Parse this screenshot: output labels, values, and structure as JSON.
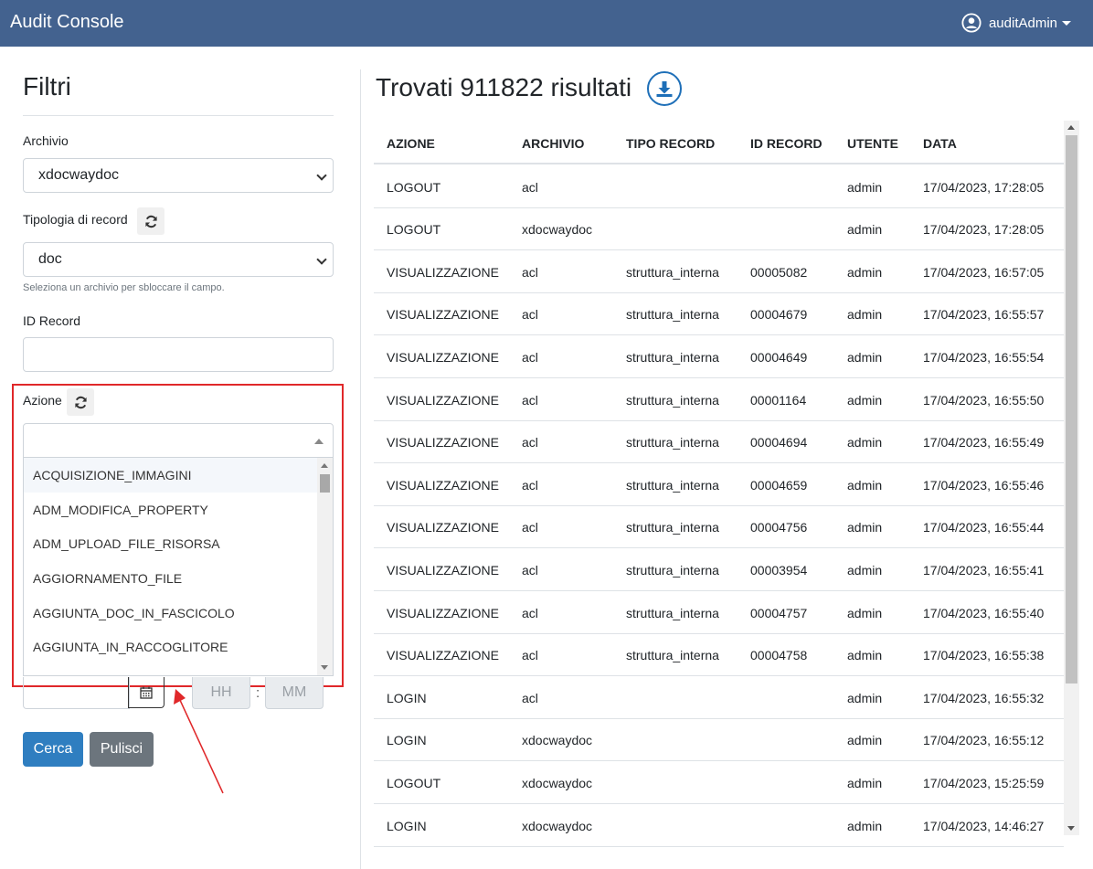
{
  "navbar": {
    "brand": "Audit Console",
    "user": "auditAdmin",
    "user_icon": "user-circle-icon"
  },
  "sidebar": {
    "title": "Filtri",
    "archivio": {
      "label": "Archivio",
      "value": "xdocwaydoc"
    },
    "tipologia": {
      "label": "Tipologia di record",
      "value": "doc",
      "hint": "Seleziona un archivio per sbloccare il campo."
    },
    "id_record": {
      "label": "ID Record",
      "value": ""
    },
    "azione": {
      "label": "Azione",
      "value": "",
      "options": [
        "ACQUISIZIONE_IMMAGINI",
        "ADM_MODIFICA_PROPERTY",
        "ADM_UPLOAD_FILE_RISORSA",
        "AGGIORNAMENTO_FILE",
        "AGGIUNTA_DOC_IN_FASCICOLO",
        "AGGIUNTA_IN_RACCOGLITORE"
      ]
    },
    "time": {
      "hh_placeholder": "HH",
      "mm_placeholder": "MM",
      "separator": ":"
    },
    "buttons": {
      "search": "Cerca",
      "clear": "Pulisci"
    }
  },
  "results": {
    "title": "Trovati 911822 risultati",
    "columns": [
      "AZIONE",
      "ARCHIVIO",
      "TIPO RECORD",
      "ID RECORD",
      "UTENTE",
      "DATA"
    ],
    "rows": [
      [
        "LOGOUT",
        "acl",
        "",
        "",
        "admin",
        "17/04/2023, 17:28:05"
      ],
      [
        "LOGOUT",
        "xdocwaydoc",
        "",
        "",
        "admin",
        "17/04/2023, 17:28:05"
      ],
      [
        "VISUALIZZAZIONE",
        "acl",
        "struttura_interna",
        "00005082",
        "admin",
        "17/04/2023, 16:57:05"
      ],
      [
        "VISUALIZZAZIONE",
        "acl",
        "struttura_interna",
        "00004679",
        "admin",
        "17/04/2023, 16:55:57"
      ],
      [
        "VISUALIZZAZIONE",
        "acl",
        "struttura_interna",
        "00004649",
        "admin",
        "17/04/2023, 16:55:54"
      ],
      [
        "VISUALIZZAZIONE",
        "acl",
        "struttura_interna",
        "00001164",
        "admin",
        "17/04/2023, 16:55:50"
      ],
      [
        "VISUALIZZAZIONE",
        "acl",
        "struttura_interna",
        "00004694",
        "admin",
        "17/04/2023, 16:55:49"
      ],
      [
        "VISUALIZZAZIONE",
        "acl",
        "struttura_interna",
        "00004659",
        "admin",
        "17/04/2023, 16:55:46"
      ],
      [
        "VISUALIZZAZIONE",
        "acl",
        "struttura_interna",
        "00004756",
        "admin",
        "17/04/2023, 16:55:44"
      ],
      [
        "VISUALIZZAZIONE",
        "acl",
        "struttura_interna",
        "00003954",
        "admin",
        "17/04/2023, 16:55:41"
      ],
      [
        "VISUALIZZAZIONE",
        "acl",
        "struttura_interna",
        "00004757",
        "admin",
        "17/04/2023, 16:55:40"
      ],
      [
        "VISUALIZZAZIONE",
        "acl",
        "struttura_interna",
        "00004758",
        "admin",
        "17/04/2023, 16:55:38"
      ],
      [
        "LOGIN",
        "acl",
        "",
        "",
        "admin",
        "17/04/2023, 16:55:32"
      ],
      [
        "LOGIN",
        "xdocwaydoc",
        "",
        "",
        "admin",
        "17/04/2023, 16:55:12"
      ],
      [
        "LOGOUT",
        "xdocwaydoc",
        "",
        "",
        "admin",
        "17/04/2023, 15:25:59"
      ],
      [
        "LOGIN",
        "xdocwaydoc",
        "",
        "",
        "admin",
        "17/04/2023, 14:46:27"
      ]
    ]
  },
  "colors": {
    "navbar": "#43628f",
    "primary": "#2f7ec0",
    "secondary": "#6c757d",
    "highlight": "#e0282a"
  }
}
